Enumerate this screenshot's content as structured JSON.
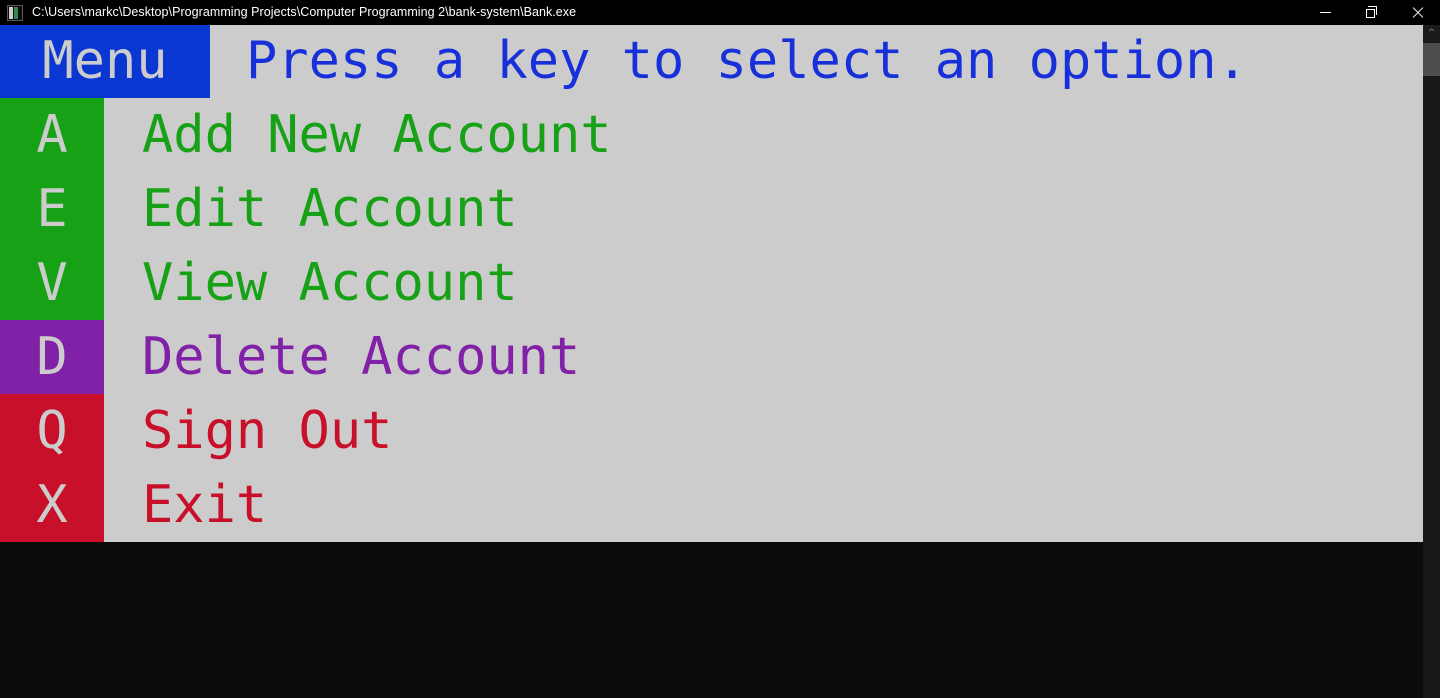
{
  "titlebar": {
    "icon": "console-window-icon",
    "path": "C:\\Users\\markc\\Desktop\\Programming Projects\\Computer Programming 2\\bank-system\\Bank.exe",
    "minimize_label": "minimize-icon",
    "maximize_label": "restore-icon",
    "close_label": "close-icon"
  },
  "console": {
    "menu_tag": "Menu",
    "prompt": "Press a key to select an option.",
    "options": [
      {
        "key": "A",
        "label": "Add New Account",
        "color": "#16a116"
      },
      {
        "key": "E",
        "label": "Edit Account",
        "color": "#16a116"
      },
      {
        "key": "V",
        "label": "View Account",
        "color": "#16a116"
      },
      {
        "key": "D",
        "label": "Delete Account",
        "color": "#8021a8"
      },
      {
        "key": "Q",
        "label": "Sign Out",
        "color": "#c8102a"
      },
      {
        "key": "X",
        "label": "Exit",
        "color": "#c8102a"
      }
    ],
    "background": "#cccccc",
    "menu_tag_background": "#0a37d2",
    "prompt_color": "#1830da"
  },
  "scrollbar": {
    "up_arrow": "^"
  }
}
